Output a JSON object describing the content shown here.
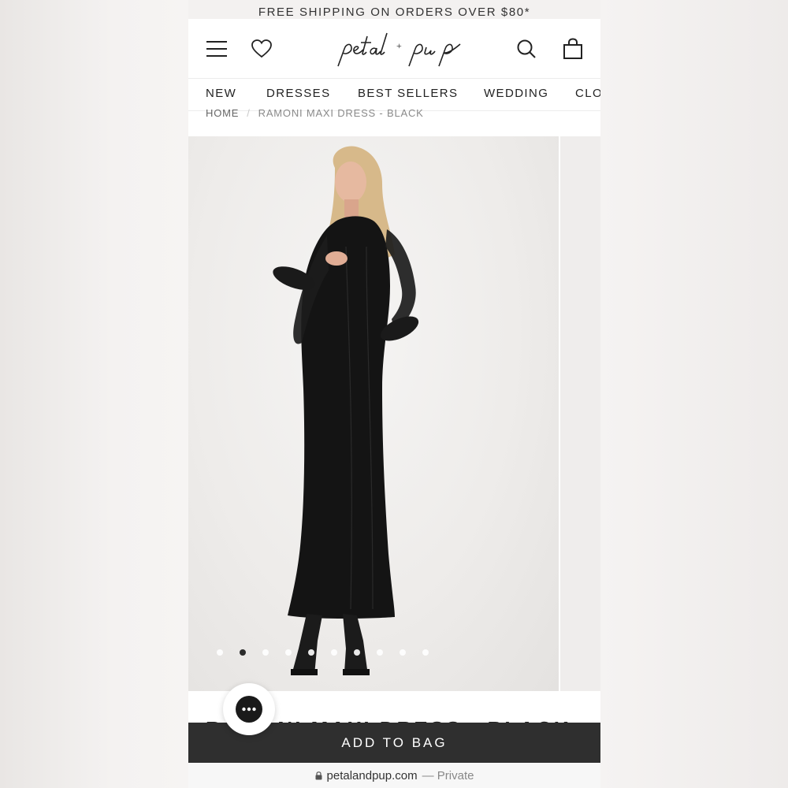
{
  "promo_bar": {
    "text": "FREE SHIPPING ON ORDERS OVER $80*"
  },
  "header": {
    "logo_text": "petal + pup",
    "icons": [
      "menu-icon",
      "heart-icon",
      "search-icon",
      "bag-icon"
    ]
  },
  "nav": {
    "items": [
      "NEW",
      "DRESSES",
      "BEST SELLERS",
      "WEDDING",
      "CLO"
    ]
  },
  "breadcrumb": {
    "home": "HOME",
    "separator": "/",
    "current": "RAMONI MAXI DRESS - BLACK"
  },
  "gallery": {
    "dot_count": 10,
    "active_index": 1
  },
  "product": {
    "title_peek": "RAMONI MAXI DRESS - BLACK"
  },
  "cta": {
    "add_to_bag": "ADD TO BAG"
  },
  "browser": {
    "url": "petalandpup.com",
    "mode": "— Private"
  },
  "colors": {
    "cta_bg": "#2f2f2f",
    "active_dot": "#2b2b2b",
    "page_bg": "#ffffff"
  }
}
